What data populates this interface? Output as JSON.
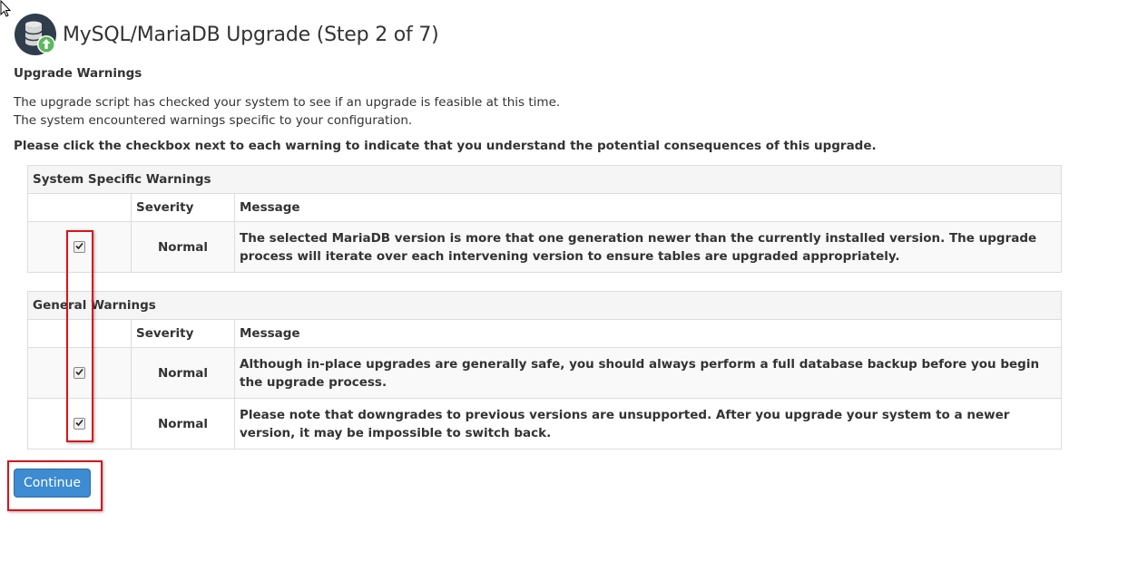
{
  "header": {
    "title": "MySQL/MariaDB Upgrade (Step 2 of 7)",
    "icon": "database-upgrade-icon"
  },
  "upgrade_warnings": {
    "heading": "Upgrade Warnings",
    "intro_line_1": "The upgrade script has checked your system to see if an upgrade is feasible at this time.",
    "intro_line_2": "The system encountered warnings specific to your configuration.",
    "instruction": "Please click the checkbox next to each warning to indicate that you understand the potential consequences of this upgrade."
  },
  "system_warnings": {
    "caption": "System Specific Warnings",
    "col_severity": "Severity",
    "col_message": "Message",
    "rows": [
      {
        "checked": true,
        "severity": "Normal",
        "message": "The selected MariaDB version is more that one generation newer than the currently installed version. The upgrade process will iterate over each intervening version to ensure tables are upgraded appropriately."
      }
    ]
  },
  "general_warnings": {
    "caption": "General Warnings",
    "col_severity": "Severity",
    "col_message": "Message",
    "rows": [
      {
        "checked": true,
        "severity": "Normal",
        "message": "Although in-place upgrades are generally safe, you should always perform a full database backup before you begin the upgrade process."
      },
      {
        "checked": true,
        "severity": "Normal",
        "message": "Please note that downgrades to previous versions are unsupported. After you upgrade your system to a newer version, it may be impossible to switch back."
      }
    ]
  },
  "actions": {
    "continue_label": "Continue"
  },
  "colors": {
    "button_blue": "#3d8bd1",
    "highlight_red": "#d9141b",
    "icon_dark": "#2f3d4c",
    "icon_green": "#5cb85c"
  }
}
